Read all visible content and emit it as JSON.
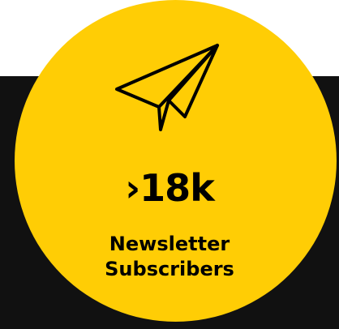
{
  "stat": {
    "value": "›18k",
    "label_line1": "Newsletter",
    "label_line2": "Subscribers"
  },
  "icon": "paper-plane-icon",
  "colors": {
    "circle": "#ffcd05",
    "dark_band": "#111111",
    "text": "#000000"
  }
}
